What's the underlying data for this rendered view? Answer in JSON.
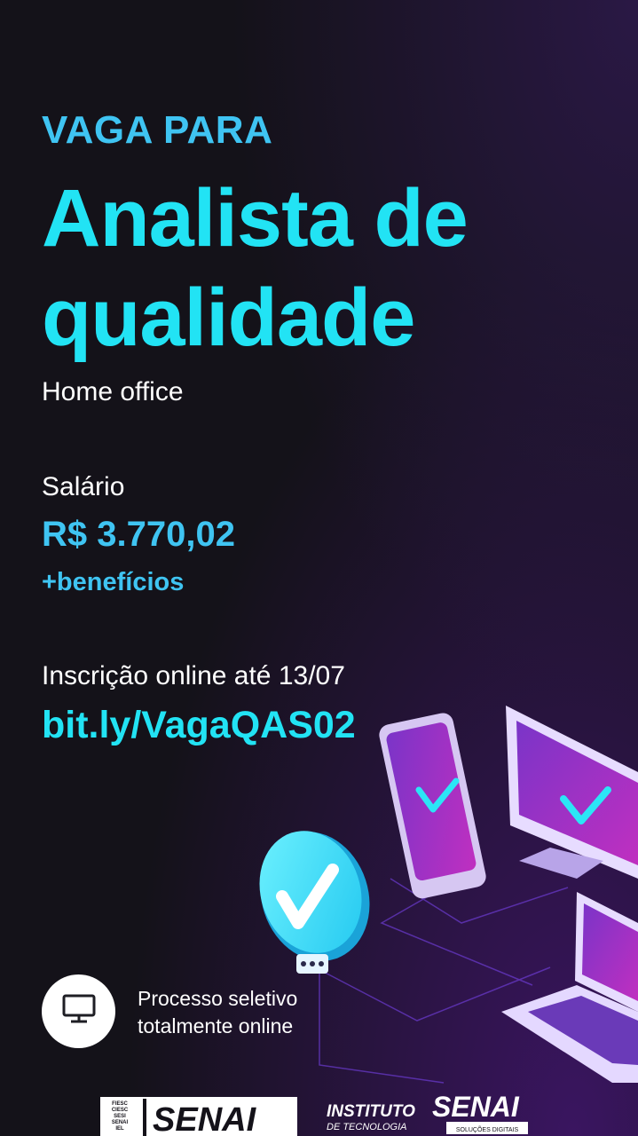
{
  "header": {
    "kicker": "VAGA PARA",
    "title_line1": "Analista de",
    "title_line2": "qualidade",
    "work_mode": "Home office"
  },
  "salary": {
    "label": "Salário",
    "value": "R$ 3.770,02",
    "extra": "+benefícios"
  },
  "registration": {
    "text": "Inscrição online até 13/07",
    "link": "bit.ly/VagaQAS02"
  },
  "process": {
    "icon": "monitor-icon",
    "line1": "Processo seletivo",
    "line2": "totalmente online"
  },
  "logos": {
    "senai_stack": [
      "FIESC",
      "CIESC",
      "SESI",
      "SENAI",
      "IEL"
    ],
    "senai": "SENAI",
    "instituto": "INSTITUTO",
    "instituto_senai": "SENAI",
    "de_tecnologia": "DE TECNOLOGIA",
    "solucoes": "SOLUÇÕES DIGITAIS"
  },
  "colors": {
    "background": "#141219",
    "cyan": "#22e3f4",
    "blue": "#3fc4f2",
    "purple": "#8a3ad0",
    "magenta": "#b02fc8"
  }
}
